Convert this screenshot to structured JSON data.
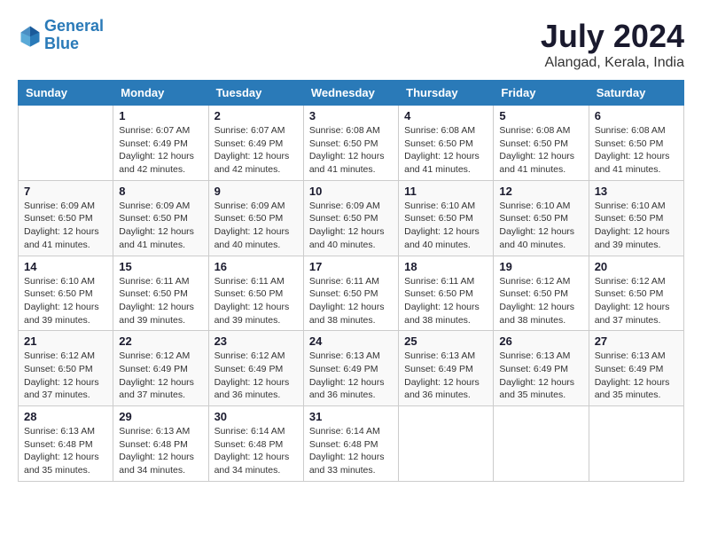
{
  "header": {
    "logo_line1": "General",
    "logo_line2": "Blue",
    "month_year": "July 2024",
    "location": "Alangad, Kerala, India"
  },
  "days_of_week": [
    "Sunday",
    "Monday",
    "Tuesday",
    "Wednesday",
    "Thursday",
    "Friday",
    "Saturday"
  ],
  "weeks": [
    [
      {
        "day": "",
        "sunrise": "",
        "sunset": "",
        "daylight": ""
      },
      {
        "day": "1",
        "sunrise": "6:07 AM",
        "sunset": "6:49 PM",
        "daylight": "12 hours and 42 minutes."
      },
      {
        "day": "2",
        "sunrise": "6:07 AM",
        "sunset": "6:49 PM",
        "daylight": "12 hours and 42 minutes."
      },
      {
        "day": "3",
        "sunrise": "6:08 AM",
        "sunset": "6:50 PM",
        "daylight": "12 hours and 41 minutes."
      },
      {
        "day": "4",
        "sunrise": "6:08 AM",
        "sunset": "6:50 PM",
        "daylight": "12 hours and 41 minutes."
      },
      {
        "day": "5",
        "sunrise": "6:08 AM",
        "sunset": "6:50 PM",
        "daylight": "12 hours and 41 minutes."
      },
      {
        "day": "6",
        "sunrise": "6:08 AM",
        "sunset": "6:50 PM",
        "daylight": "12 hours and 41 minutes."
      }
    ],
    [
      {
        "day": "7",
        "sunrise": "6:09 AM",
        "sunset": "6:50 PM",
        "daylight": "12 hours and 41 minutes."
      },
      {
        "day": "8",
        "sunrise": "6:09 AM",
        "sunset": "6:50 PM",
        "daylight": "12 hours and 41 minutes."
      },
      {
        "day": "9",
        "sunrise": "6:09 AM",
        "sunset": "6:50 PM",
        "daylight": "12 hours and 40 minutes."
      },
      {
        "day": "10",
        "sunrise": "6:09 AM",
        "sunset": "6:50 PM",
        "daylight": "12 hours and 40 minutes."
      },
      {
        "day": "11",
        "sunrise": "6:10 AM",
        "sunset": "6:50 PM",
        "daylight": "12 hours and 40 minutes."
      },
      {
        "day": "12",
        "sunrise": "6:10 AM",
        "sunset": "6:50 PM",
        "daylight": "12 hours and 40 minutes."
      },
      {
        "day": "13",
        "sunrise": "6:10 AM",
        "sunset": "6:50 PM",
        "daylight": "12 hours and 39 minutes."
      }
    ],
    [
      {
        "day": "14",
        "sunrise": "6:10 AM",
        "sunset": "6:50 PM",
        "daylight": "12 hours and 39 minutes."
      },
      {
        "day": "15",
        "sunrise": "6:11 AM",
        "sunset": "6:50 PM",
        "daylight": "12 hours and 39 minutes."
      },
      {
        "day": "16",
        "sunrise": "6:11 AM",
        "sunset": "6:50 PM",
        "daylight": "12 hours and 39 minutes."
      },
      {
        "day": "17",
        "sunrise": "6:11 AM",
        "sunset": "6:50 PM",
        "daylight": "12 hours and 38 minutes."
      },
      {
        "day": "18",
        "sunrise": "6:11 AM",
        "sunset": "6:50 PM",
        "daylight": "12 hours and 38 minutes."
      },
      {
        "day": "19",
        "sunrise": "6:12 AM",
        "sunset": "6:50 PM",
        "daylight": "12 hours and 38 minutes."
      },
      {
        "day": "20",
        "sunrise": "6:12 AM",
        "sunset": "6:50 PM",
        "daylight": "12 hours and 37 minutes."
      }
    ],
    [
      {
        "day": "21",
        "sunrise": "6:12 AM",
        "sunset": "6:50 PM",
        "daylight": "12 hours and 37 minutes."
      },
      {
        "day": "22",
        "sunrise": "6:12 AM",
        "sunset": "6:49 PM",
        "daylight": "12 hours and 37 minutes."
      },
      {
        "day": "23",
        "sunrise": "6:12 AM",
        "sunset": "6:49 PM",
        "daylight": "12 hours and 36 minutes."
      },
      {
        "day": "24",
        "sunrise": "6:13 AM",
        "sunset": "6:49 PM",
        "daylight": "12 hours and 36 minutes."
      },
      {
        "day": "25",
        "sunrise": "6:13 AM",
        "sunset": "6:49 PM",
        "daylight": "12 hours and 36 minutes."
      },
      {
        "day": "26",
        "sunrise": "6:13 AM",
        "sunset": "6:49 PM",
        "daylight": "12 hours and 35 minutes."
      },
      {
        "day": "27",
        "sunrise": "6:13 AM",
        "sunset": "6:49 PM",
        "daylight": "12 hours and 35 minutes."
      }
    ],
    [
      {
        "day": "28",
        "sunrise": "6:13 AM",
        "sunset": "6:48 PM",
        "daylight": "12 hours and 35 minutes."
      },
      {
        "day": "29",
        "sunrise": "6:13 AM",
        "sunset": "6:48 PM",
        "daylight": "12 hours and 34 minutes."
      },
      {
        "day": "30",
        "sunrise": "6:14 AM",
        "sunset": "6:48 PM",
        "daylight": "12 hours and 34 minutes."
      },
      {
        "day": "31",
        "sunrise": "6:14 AM",
        "sunset": "6:48 PM",
        "daylight": "12 hours and 33 minutes."
      },
      {
        "day": "",
        "sunrise": "",
        "sunset": "",
        "daylight": ""
      },
      {
        "day": "",
        "sunrise": "",
        "sunset": "",
        "daylight": ""
      },
      {
        "day": "",
        "sunrise": "",
        "sunset": "",
        "daylight": ""
      }
    ]
  ]
}
